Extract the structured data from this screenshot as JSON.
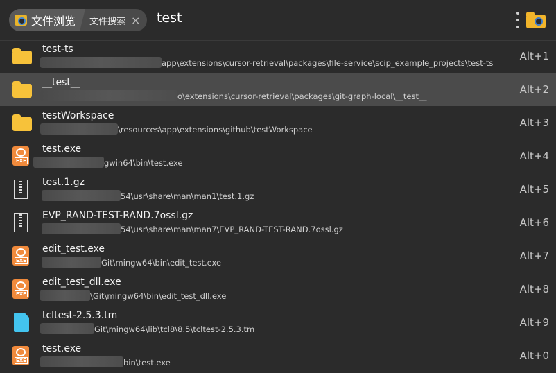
{
  "topbar": {
    "breadcrumb_root": "文件浏览",
    "breadcrumb_tab": "文件搜索",
    "close_glyph": "×",
    "query": "test"
  },
  "results": [
    {
      "name": "test-ts",
      "path": "app\\extensions\\cursor-retrieval\\packages\\file-service\\scip_example_projects\\test-ts",
      "shortcut": "Alt+1",
      "icon": "folder-icon"
    },
    {
      "name": "__test__",
      "path": "o\\extensions\\cursor-retrieval\\packages\\git-graph-local\\__test__",
      "shortcut": "Alt+2",
      "icon": "folder-icon"
    },
    {
      "name": "testWorkspace",
      "path": "\\resources\\app\\extensions\\github\\testWorkspace",
      "shortcut": "Alt+3",
      "icon": "folder-icon"
    },
    {
      "name": "test.exe",
      "path": "gwin64\\bin\\test.exe",
      "shortcut": "Alt+4",
      "icon": "exe-icon"
    },
    {
      "name": "test.1.gz",
      "path": "54\\usr\\share\\man\\man1\\test.1.gz",
      "shortcut": "Alt+5",
      "icon": "archive-icon"
    },
    {
      "name": "EVP_RAND-TEST-RAND.7ossl.gz",
      "path": "54\\usr\\share\\man\\man7\\EVP_RAND-TEST-RAND.7ossl.gz",
      "shortcut": "Alt+6",
      "icon": "archive-icon"
    },
    {
      "name": "edit_test.exe",
      "path": "Git\\mingw64\\bin\\edit_test.exe",
      "shortcut": "Alt+7",
      "icon": "exe-icon"
    },
    {
      "name": "edit_test_dll.exe",
      "path": "\\Git\\mingw64\\bin\\edit_test_dll.exe",
      "shortcut": "Alt+8",
      "icon": "exe-icon"
    },
    {
      "name": "tcltest-2.5.3.tm",
      "path": "Git\\mingw64\\lib\\tcl8\\8.5\\tcltest-2.5.3.tm",
      "shortcut": "Alt+9",
      "icon": "document-icon"
    },
    {
      "name": "test.exe",
      "path": "bin\\test.exe",
      "shortcut": "Alt+0",
      "icon": "exe-icon"
    }
  ],
  "colors": {
    "background": "#2b2b2b",
    "selected_row": "#4b4b4b",
    "folder": "#f7c23a",
    "exe": "#f08a3c",
    "document": "#43c4ef"
  }
}
